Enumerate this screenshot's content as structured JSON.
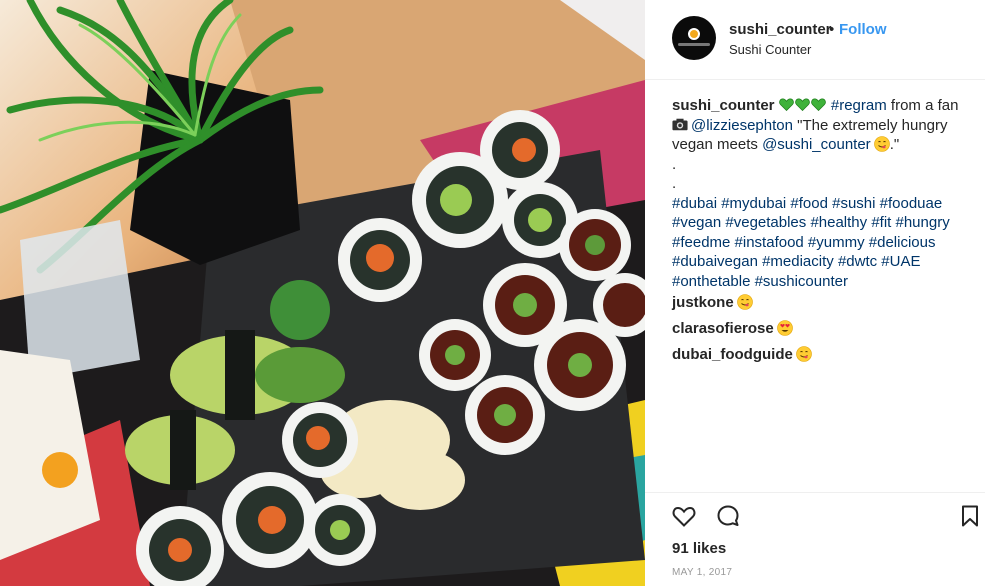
{
  "post": {
    "username": "sushi_counter",
    "separator": "•",
    "follow_label": "Follow",
    "location": "Sushi Counter"
  },
  "caption": {
    "username": "sushi_counter",
    "hearts": [
      "green-heart",
      "green-heart",
      "green-heart"
    ],
    "regram_tag": "#regram",
    "from_text": " from a fan",
    "camera_icon": "camera-icon",
    "mention_fan": "@lizziesephton",
    "quote_start": " \"The extremely hungry",
    "line3_text": "vegan meets ",
    "mention_brand": "@sushi_counter",
    "quote_end": ".\"",
    "dot1": ".",
    "dot2": ".",
    "hashtag_lines": [
      "#dubai #mydubai #food #sushi #fooduae",
      "#vegan #vegetables #healthy #fit #hungry",
      "#feedme #instafood #yummy #delicious",
      "#dubaivegan #mediacity #dwtc #UAE",
      "#onthetable #sushicounter"
    ]
  },
  "comments": [
    {
      "username": "justkone",
      "emoji": "face-savoring-food"
    },
    {
      "username": "clarasofierose",
      "emoji": "heart-eyes"
    },
    {
      "username": "dubai_foodguide",
      "emoji": "face-savoring-food"
    }
  ],
  "stats": {
    "likes": "91 likes",
    "date": "MAY 1, 2017"
  },
  "icons": {
    "like": "heart-outline-icon",
    "comment": "comment-bubble-icon",
    "save": "bookmark-icon"
  },
  "colors": {
    "link": "#3897f0",
    "hashtag": "#003569",
    "heart_green": "#3fb23a"
  }
}
